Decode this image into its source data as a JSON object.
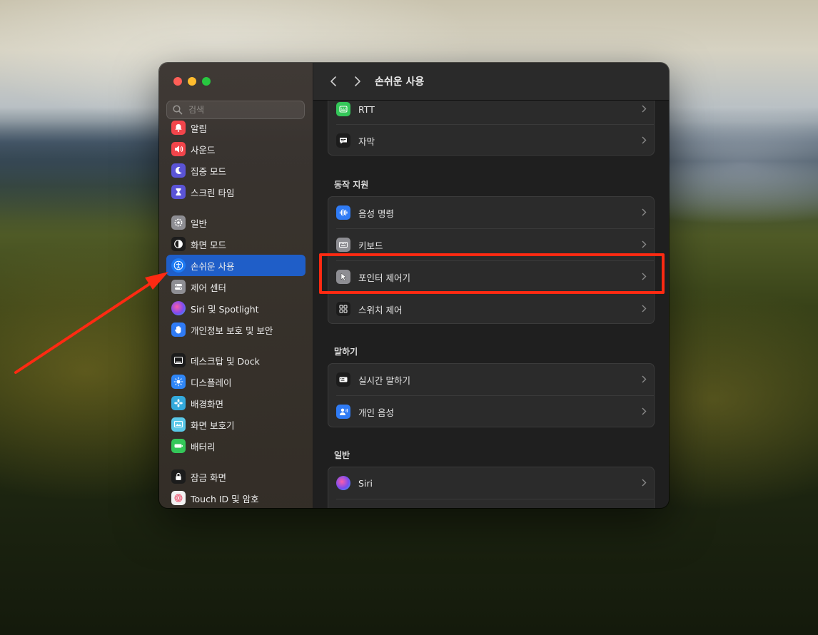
{
  "window": {
    "title": "손쉬운 사용"
  },
  "search": {
    "placeholder": "검색"
  },
  "sidebar": {
    "items": [
      {
        "label": "알림",
        "icon": "bell-icon",
        "color": "#f2454b"
      },
      {
        "label": "사운드",
        "icon": "speaker-icon",
        "color": "#f2454b"
      },
      {
        "label": "집중 모드",
        "icon": "moon-icon",
        "color": "#5b54d6"
      },
      {
        "label": "스크린 타임",
        "icon": "hourglass-icon",
        "color": "#5b54d6"
      },
      {
        "label": "일반",
        "icon": "gear-icon",
        "color": "#8e8e93"
      },
      {
        "label": "화면 모드",
        "icon": "appearance-icon",
        "color": "#1c1c1c"
      },
      {
        "label": "손쉬운 사용",
        "icon": "accessibility-icon",
        "color": "#1d7af3",
        "active": true
      },
      {
        "label": "제어 센터",
        "icon": "control-center-icon",
        "color": "#8e8e93"
      },
      {
        "label": "Siri 및 Spotlight",
        "icon": "siri-icon",
        "color": "#b04bd8"
      },
      {
        "label": "개인정보 보호 및 보안",
        "icon": "hand-icon",
        "color": "#2f7bf5"
      },
      {
        "label": "데스크탑 및 Dock",
        "icon": "dock-icon",
        "color": "#1c1c1c"
      },
      {
        "label": "디스플레이",
        "icon": "sun-icon",
        "color": "#2f86f6"
      },
      {
        "label": "배경화면",
        "icon": "flower-icon",
        "color": "#34aadc"
      },
      {
        "label": "화면 보호기",
        "icon": "screensaver-icon",
        "color": "#5ac8e8"
      },
      {
        "label": "배터리",
        "icon": "battery-icon",
        "color": "#34c759"
      },
      {
        "label": "잠금 화면",
        "icon": "lock-icon",
        "color": "#1c1c1c"
      },
      {
        "label": "Touch ID 및 암호",
        "icon": "fingerprint-icon",
        "color": "#f2f2f2"
      }
    ]
  },
  "content": {
    "groups": [
      {
        "heading": "",
        "rows": [
          {
            "label": "RTT",
            "icon": "rtt-icon",
            "color": "#34c759"
          },
          {
            "label": "자막",
            "icon": "captions-icon",
            "color": "#1c1c1c"
          }
        ]
      },
      {
        "heading": "동작 지원",
        "rows": [
          {
            "label": "음성 명령",
            "icon": "waveform-icon",
            "color": "#2f7bf5"
          },
          {
            "label": "키보드",
            "icon": "keyboard-icon",
            "color": "#8e8e93"
          },
          {
            "label": "포인터 제어기",
            "icon": "pointer-icon",
            "color": "#8e8e93"
          },
          {
            "label": "스위치 제어",
            "icon": "switch-control-icon",
            "color": "#1c1c1c"
          }
        ]
      },
      {
        "heading": "말하기",
        "rows": [
          {
            "label": "실시간 말하기",
            "icon": "live-speech-icon",
            "color": "#1c1c1c"
          },
          {
            "label": "개인 음성",
            "icon": "personal-voice-icon",
            "color": "#2f7bf5"
          }
        ]
      },
      {
        "heading": "일반",
        "rows": [
          {
            "label": "Siri",
            "icon": "siri-icon",
            "color": "#1c1c1c"
          }
        ]
      }
    ]
  },
  "annotation": {
    "highlight_color": "#ff2a12"
  }
}
